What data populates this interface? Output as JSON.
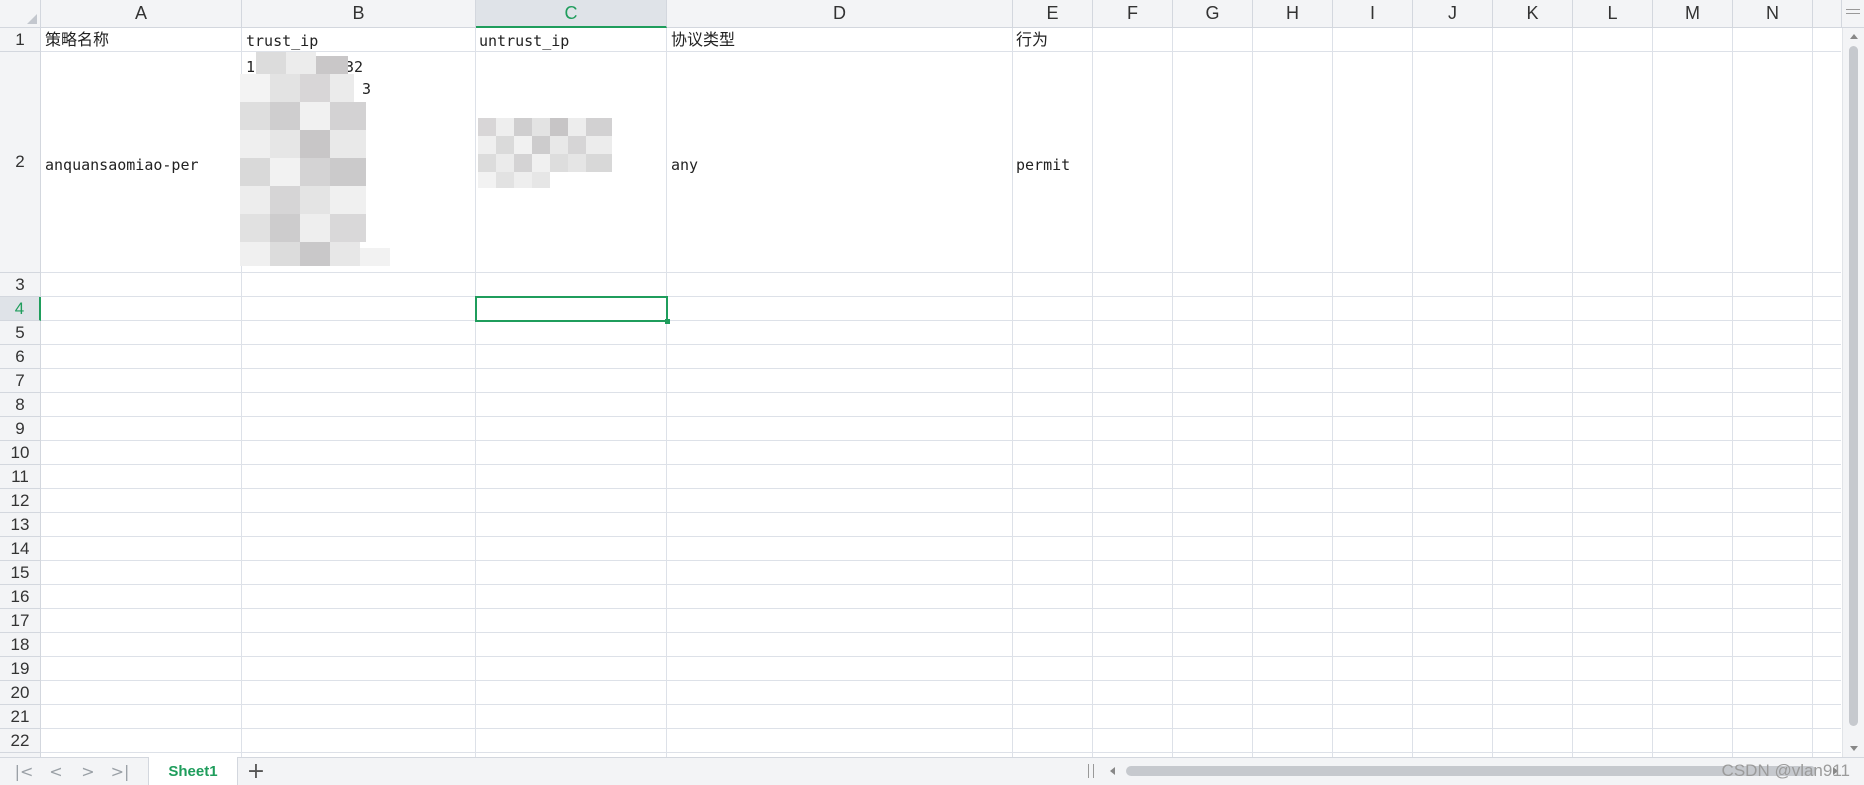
{
  "columns": [
    "A",
    "B",
    "C",
    "D",
    "E",
    "F",
    "G",
    "H",
    "I",
    "J",
    "K",
    "L",
    "M",
    "N"
  ],
  "active_column": "C",
  "rows": [
    "1",
    "2",
    "3",
    "4",
    "5",
    "6",
    "7",
    "8",
    "9",
    "10",
    "11",
    "12",
    "13",
    "14",
    "15",
    "16",
    "17",
    "18",
    "19",
    "20",
    "21",
    "22"
  ],
  "active_row": "4",
  "cells": {
    "A1": "策略名称",
    "B1": "trust_ip",
    "C1": "untrust_ip",
    "D1": "协议类型",
    "E1": "行为",
    "A2": "anquansaomiao-per",
    "B2_line1_start": "1",
    "B2_line1_end": "32",
    "B2_line2_end": "3",
    "D2": "any",
    "E2": "permit"
  },
  "bottom_bar": {
    "sheet_tab": "Sheet1",
    "add_sheet": "+",
    "nav_first": "|<",
    "nav_prev": "<",
    "nav_next": ">",
    "nav_last": ">|"
  },
  "watermark": "CSDN @vlan911",
  "colors": {
    "accent": "#1f9d5c",
    "header_bg": "#f3f4f6",
    "gridline": "#dde1e8"
  }
}
